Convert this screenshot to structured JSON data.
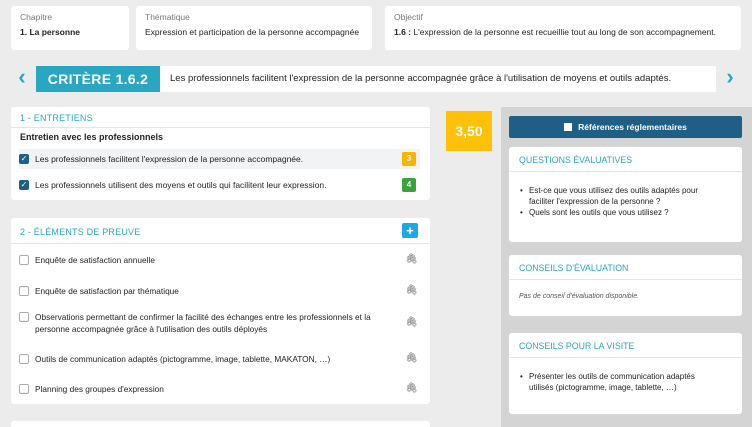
{
  "top": {
    "chapitre": {
      "label": "Chapitre",
      "value": "1. La personne"
    },
    "thematique": {
      "label": "Thématique",
      "value": "Expression et participation de la personne accompagnée"
    },
    "objectif": {
      "label": "Objectif",
      "value_num": "1.6 :",
      "value_text": " L'expression de la personne est recueillie tout au long de son accompagnement."
    }
  },
  "critere": {
    "badge": "CRITÈRE 1.6.2",
    "text": "Les professionnels facilitent l'expression de la personne accompagnée grâce à l'utilisation de moyens et outils adaptés."
  },
  "entretiens": {
    "title": "1 - ENTRETIENS",
    "subtitle": "Entretien avec les professionnels",
    "items": [
      {
        "label": "Les professionnels facilitent l'expression de la personne accompagnée.",
        "score": "3",
        "color": "#f7b500"
      },
      {
        "label": "Les professionnels utilisent des moyens et outils qui facilitent leur expression.",
        "score": "4",
        "color": "#3ba33b"
      }
    ]
  },
  "total_score": "3,50",
  "preuves": {
    "title": "2 - ÉLÉMENTS DE PREUVE",
    "add_label": "+",
    "items": [
      {
        "label": "Enquête de satisfaction annuelle"
      },
      {
        "label": "Enquête de satisfaction par thématique"
      },
      {
        "label1": "Observations permettant de confirmer la facilité des échanges entre les professionnels et la",
        "label2": "personne accompagnée grâce à l'utilisation des outils déployés"
      },
      {
        "label": "Outils de communication adaptés (pictogramme, image, tablette, MAKATON, …)"
      },
      {
        "label": "Planning des groupes d'expression"
      }
    ]
  },
  "right": {
    "ref_button": "Références réglementaires",
    "questions": {
      "title": "QUESTIONS ÉVALUATIVES",
      "items": [
        "Est-ce que vous utilisez des outils adaptés pour faciliter l'expression de la personne ?",
        "Quels sont les outils que vous utilisez ?"
      ]
    },
    "conseils_eval": {
      "title": "CONSEILS D'ÉVALUATION",
      "note": "Pas de conseil d'évaluation disponible."
    },
    "conseils_visite": {
      "title": "CONSEILS POUR LA VISITE",
      "items": [
        "Présenter les outils de communication adaptés utilisés (pictogramme, image, tablette, …)"
      ]
    }
  },
  "colors": {
    "accent": "#29a6c1",
    "navy": "#1f5f85",
    "yellow": "#ffc107"
  }
}
